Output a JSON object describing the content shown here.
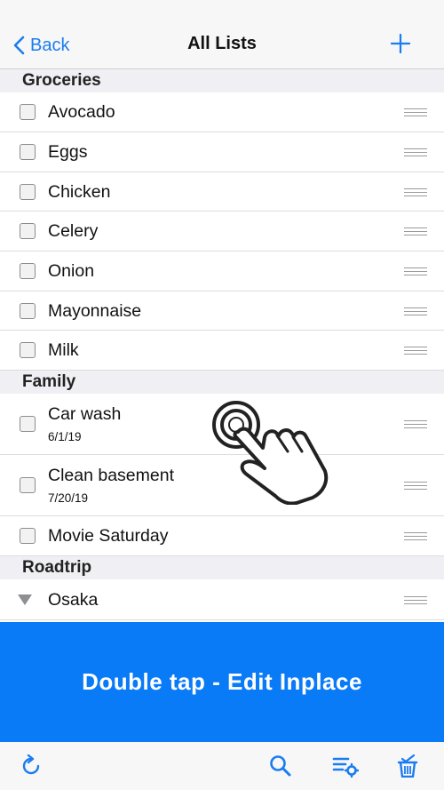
{
  "nav": {
    "back_label": "Back",
    "title": "All Lists",
    "add_icon": "plus-icon"
  },
  "colors": {
    "accent": "#1a7cf0",
    "banner": "#0a7bf7",
    "section_bg": "#efeff4"
  },
  "sections": [
    {
      "title": "Groceries",
      "items": [
        {
          "label": "Avocado"
        },
        {
          "label": "Eggs"
        },
        {
          "label": "Chicken"
        },
        {
          "label": "Celery"
        },
        {
          "label": "Onion"
        },
        {
          "label": "Mayonnaise"
        },
        {
          "label": "Milk"
        }
      ]
    },
    {
      "title": "Family",
      "items": [
        {
          "label": "Car wash",
          "date": "6/1/19"
        },
        {
          "label": "Clean basement",
          "date": "7/20/19"
        },
        {
          "label": "Movie Saturday"
        }
      ]
    },
    {
      "title": "Roadtrip",
      "items": [
        {
          "label": "Osaka",
          "expandable": true
        }
      ]
    }
  ],
  "banner": {
    "text": "Double tap - Edit Inplace"
  },
  "toolbar": {
    "icons": [
      "refresh-icon",
      "search-icon",
      "list-settings-icon",
      "delete-checked-icon"
    ]
  }
}
